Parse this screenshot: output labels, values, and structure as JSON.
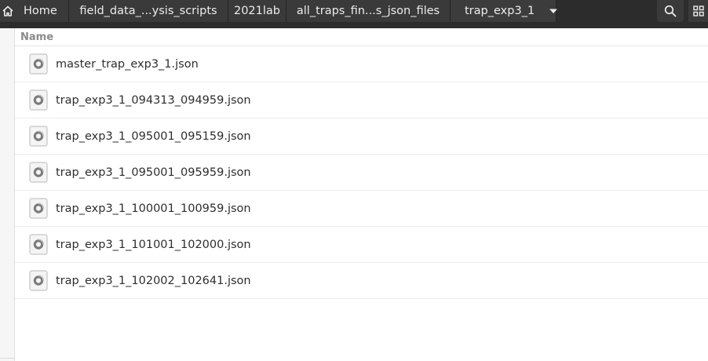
{
  "breadcrumb": {
    "home_label": "Home",
    "items": [
      {
        "label": "field_data_...ysis_scripts"
      },
      {
        "label": "2021lab"
      },
      {
        "label": "all_traps_fin...s_json_files"
      },
      {
        "label": "trap_exp3_1"
      }
    ]
  },
  "toolbar": {
    "search_icon": "search-icon",
    "view_icon": "grid-view-icon"
  },
  "file_list": {
    "column_header": "Name",
    "files": [
      {
        "name": "master_trap_exp3_1.json",
        "icon": "json-file-icon"
      },
      {
        "name": "trap_exp3_1_094313_094959.json",
        "icon": "json-file-icon"
      },
      {
        "name": "trap_exp3_1_095001_095159.json",
        "icon": "json-file-icon"
      },
      {
        "name": "trap_exp3_1_095001_095959.json",
        "icon": "json-file-icon"
      },
      {
        "name": "trap_exp3_1_100001_100959.json",
        "icon": "json-file-icon"
      },
      {
        "name": "trap_exp3_1_101001_102000.json",
        "icon": "json-file-icon"
      },
      {
        "name": "trap_exp3_1_102002_102641.json",
        "icon": "json-file-icon"
      }
    ]
  },
  "colors": {
    "header_bg": "#2c2c2c",
    "crumb_bg": "#3a3a3a",
    "text_light": "#ececec",
    "list_text": "#2e2e2e",
    "header_text": "#8a8a8a"
  }
}
